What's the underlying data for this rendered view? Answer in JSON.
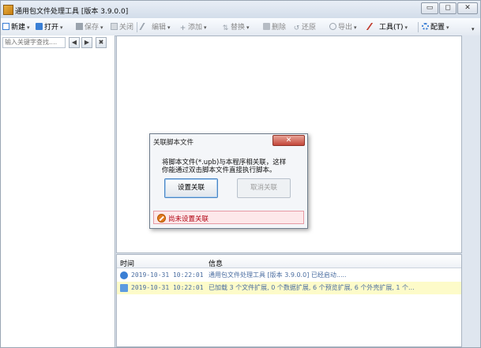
{
  "window": {
    "title": "通用包文件处理工具 [版本 3.9.0.0]",
    "controls": {
      "minimize": "▭",
      "maximize": "◻",
      "close": "✕"
    }
  },
  "toolbar": {
    "items": [
      {
        "label": "新建",
        "icon": "new-file-icon",
        "color": "#3a7fd5",
        "dropdown": true,
        "enabled": true
      },
      {
        "label": "打开",
        "icon": "open-folder-icon",
        "color": "#3a7fd5",
        "dropdown": true,
        "enabled": true
      },
      {
        "label": "保存",
        "icon": "save-icon",
        "color": "#8a8a8a",
        "dropdown": true,
        "enabled": false
      },
      {
        "label": "关闭",
        "icon": "close-file-icon",
        "color": "#8a8a8a",
        "dropdown": false,
        "enabled": false
      },
      {
        "label": "编辑",
        "icon": "edit-icon",
        "color": "#8a8a8a",
        "dropdown": true,
        "enabled": false
      },
      {
        "label": "添加",
        "icon": "add-icon",
        "color": "#8a8a8a",
        "dropdown": true,
        "enabled": false
      },
      {
        "label": "替换",
        "icon": "replace-icon",
        "color": "#8a8a8a",
        "dropdown": true,
        "enabled": false
      },
      {
        "label": "删除",
        "icon": "delete-icon",
        "color": "#8a8a8a",
        "dropdown": false,
        "enabled": false
      },
      {
        "label": "还原",
        "icon": "restore-icon",
        "color": "#8a8a8a",
        "dropdown": false,
        "enabled": false
      },
      {
        "label": "导出",
        "icon": "export-icon",
        "color": "#8a8a8a",
        "dropdown": true,
        "enabled": false
      },
      {
        "label": "工具(T)",
        "icon": "tools-icon",
        "color": "#c0392b",
        "dropdown": true,
        "enabled": true
      },
      {
        "label": "配置",
        "icon": "settings-icon",
        "color": "#3a7fd5",
        "dropdown": true,
        "enabled": true
      }
    ],
    "dropdown_glyph": "▾",
    "overflow_glyph": "▾"
  },
  "left_panel": {
    "search_placeholder": "输入关键字查找....",
    "buttons": {
      "prev": "◀",
      "next": "▶",
      "clear": "✖"
    }
  },
  "log": {
    "headers": {
      "time": "时间",
      "info": "信息"
    },
    "rows": [
      {
        "time": "2019-10-31 10:22:01",
        "message": "通用包文件处理工具 [版本 3.9.0.0] 已经启动.....",
        "icon": "info-icon",
        "highlight": false
      },
      {
        "time": "2019-10-31 10:22:01",
        "message": "已加载 3 个文件扩展, 0 个数据扩展, 6 个预览扩展, 6 个外壳扩展, 1 个...",
        "icon": "message-icon",
        "highlight": true
      }
    ]
  },
  "dialog": {
    "title": "关联脚本文件",
    "close_glyph": "✕",
    "message_line1": "将脚本文件(*.upb)与本程序相关联，这样",
    "message_line2": "你能通过双击脚本文件直接执行脚本。",
    "set_button": "设置关联",
    "cancel_button": "取消关联",
    "status_text": "尚未设置关联",
    "status_color": "#b00010"
  }
}
